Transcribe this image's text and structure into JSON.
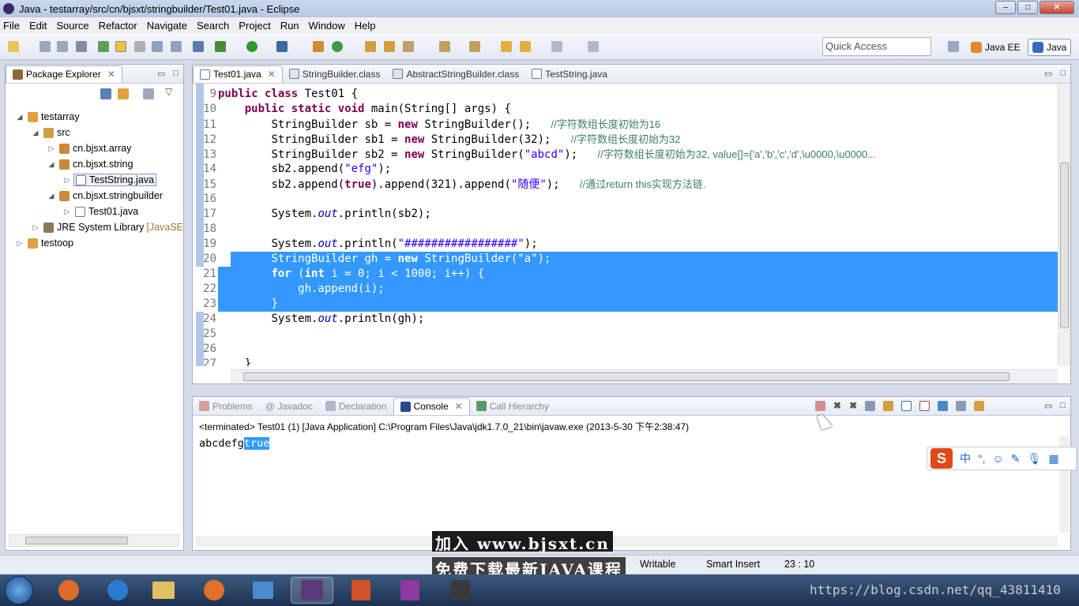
{
  "window": {
    "title": "Java - testarray/src/cn/bjsxt/stringbuilder/Test01.java - Eclipse",
    "min": "–",
    "max": "□",
    "close": "✕"
  },
  "menu": [
    "File",
    "Edit",
    "Source",
    "Refactor",
    "Navigate",
    "Search",
    "Project",
    "Run",
    "Window",
    "Help"
  ],
  "quick_access": {
    "placeholder": "Quick Access"
  },
  "perspectives": [
    "Java EE",
    "Java"
  ],
  "package_explorer": {
    "tab": "Package Explorer",
    "items": [
      {
        "label": "testarray",
        "twisty": "◢"
      },
      {
        "label": "src",
        "twisty": "◢"
      },
      {
        "label": "cn.bjsxt.array",
        "twisty": "▷"
      },
      {
        "label": "cn.bjsxt.string",
        "twisty": "◢"
      },
      {
        "label": "TestString.java",
        "twisty": "▷"
      },
      {
        "label": "cn.bjsxt.stringbuilder",
        "twisty": "◢"
      },
      {
        "label": "Test01.java",
        "twisty": "▷"
      },
      {
        "label": "JRE System Library",
        "suffix": "[JavaSE",
        "twisty": "▷"
      },
      {
        "label": "testoop",
        "twisty": "▷"
      }
    ]
  },
  "editor": {
    "tabs": [
      "Test01.java",
      "StringBuilder.class",
      "AbstractStringBuilder.class",
      "TestString.java"
    ],
    "lines": [
      "9",
      "10",
      "11",
      "12",
      "13",
      "14",
      "15",
      "16",
      "17",
      "18",
      "19",
      "20",
      "21",
      "22",
      "23",
      "24",
      "25",
      "26",
      "27"
    ],
    "code": {
      "l9_kw": "public class ",
      "l9_rest": "Test01 {",
      "l10_kw": "public static void ",
      "l10_rest": "main(String[] args) {",
      "l11_a": "StringBuilder sb = ",
      "l11_kw": "new",
      "l11_b": " StringBuilder();   ",
      "l11_cm": "//字符数组长度初始为16",
      "l12_a": "StringBuilder sb1 = ",
      "l12_kw": "new",
      "l12_b": " StringBuilder(32);   ",
      "l12_cm": "//字符数组长度初始为32",
      "l13_a": "StringBuilder sb2 = ",
      "l13_kw": "new",
      "l13_b": " StringBuilder(",
      "l13_str": "\"abcd\"",
      "l13_c": ");   ",
      "l13_cm": "//字符数组长度初始为32, value[]={'a','b','c','d',\\u0000,\\u0000...",
      "l14_a": "sb2.append(",
      "l14_str": "\"efg\"",
      "l14_b": ");",
      "l15_a": "sb2.append(",
      "l15_kw": "true",
      "l15_b": ").append(321).append(",
      "l15_str": "\"随便\"",
      "l15_c": ");   ",
      "l15_cm": "//通过return this实现方法链.",
      "l17_a": "System.",
      "l17_it": "out",
      "l17_b": ".println(sb2);",
      "l19_a": "System.",
      "l19_it": "out",
      "l19_b": ".println(",
      "l19_str": "\"#################\"",
      "l19_c": ");",
      "l20_a": "StringBuilder gh = ",
      "l20_kw": "new",
      "l20_b": " StringBuilder(",
      "l20_str": "\"a\"",
      "l20_c": ");",
      "l21_kw": "for",
      "l21_a": " (",
      "l21_kw2": "int",
      "l21_b": " i = 0; i < 1000; i++) {",
      "l22_a": "gh.append(i);",
      "l23_a": "}",
      "l24_a": "System.",
      "l24_it": "out",
      "l24_b": ".println(gh);",
      "l27_a": "}"
    }
  },
  "console": {
    "tabs": [
      "Problems",
      "@ Javadoc",
      "Declaration",
      "Console",
      "Call Hierarchy"
    ],
    "header": "<terminated> Test01 (1) [Java Application] C:\\Program Files\\Java\\jdk1.7.0_21\\bin\\javaw.exe (2013-5-30 下午2:38:47)",
    "output_plain": "abcdefg",
    "output_selected": "true"
  },
  "status": {
    "writable": "Writable",
    "insert": "Smart Insert",
    "position": "23 : 10"
  },
  "watermark": {
    "line1": "加入 www.bjsxt.cn",
    "line2": "免费下载最新JAVA课程",
    "url": "https://blog.csdn.net/qq_43811410"
  },
  "ime": {
    "items": [
      "中",
      "°,",
      "☺",
      "✎",
      "🎙",
      "▦"
    ]
  },
  "colors": {
    "selection": "#3399ff",
    "keyword": "#7f0055",
    "string": "#2a00ff",
    "comment": "#3f7f5f"
  }
}
